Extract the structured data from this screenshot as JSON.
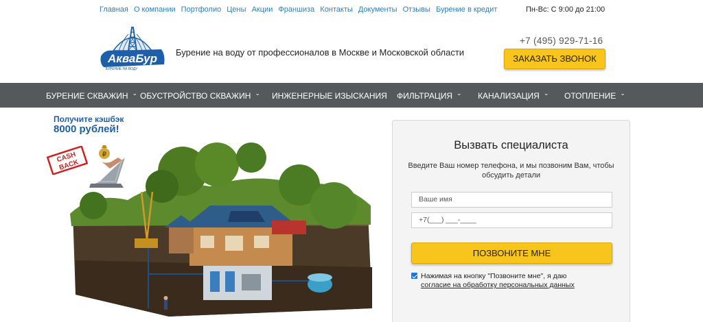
{
  "topnav": {
    "links": [
      "Главная",
      "О компании",
      "Портфолио",
      "Цены",
      "Акции",
      "Франшиза",
      "Контакты",
      "Документы",
      "Отзывы",
      "Бурение в кредит"
    ]
  },
  "header": {
    "hours": "Пн-Вс: С 9:00 до 21:00",
    "logo_text": "АкваБур",
    "logo_subtext": "БУРЕНИЕ НА ВОДУ",
    "tagline": "Бурение на воду от профессионалов в Москве и Московской области",
    "phone": "+7 (495) 929-71-16",
    "call_button": "ЗАКАЗАТЬ ЗВОНОК"
  },
  "mainnav": {
    "items": [
      {
        "label": "БУРЕНИЕ СКВАЖИН",
        "chevron": true
      },
      {
        "label": "ОБУСТРОЙСТВО СКВАЖИН",
        "chevron": true
      },
      {
        "label": "ИНЖЕНЕРНЫЕ ИЗЫСКАНИЯ",
        "chevron": false
      },
      {
        "label": "ФИЛЬТРАЦИЯ",
        "chevron": true
      },
      {
        "label": "КАНАЛИЗАЦИЯ",
        "chevron": true
      },
      {
        "label": "ОТОПЛЕНИЕ",
        "chevron": true
      }
    ]
  },
  "promo": {
    "line1": "Получите кэшбэк",
    "line2": "8000 рублей!",
    "stamp_text": "CASH BACK"
  },
  "form": {
    "title": "Вызвать специалиста",
    "description": "Введите Ваш номер телефона, и мы позвоним Вам, чтобы обсудить детали",
    "name_placeholder": "Ваше имя",
    "phone_value": "+7(___) ___-____",
    "submit": "ПОЗВОНИТЕ МНЕ",
    "consent_text": "Нажимая на кнопку \"Позвоните мне\", я даю",
    "consent_link": "согласие на обработку персональных данных",
    "consent_checked": true
  },
  "colors": {
    "accent_yellow": "#f7c51b",
    "nav_bg": "#56595c",
    "link_blue": "#2a7fc1",
    "logo_blue": "#1d5fa8"
  }
}
